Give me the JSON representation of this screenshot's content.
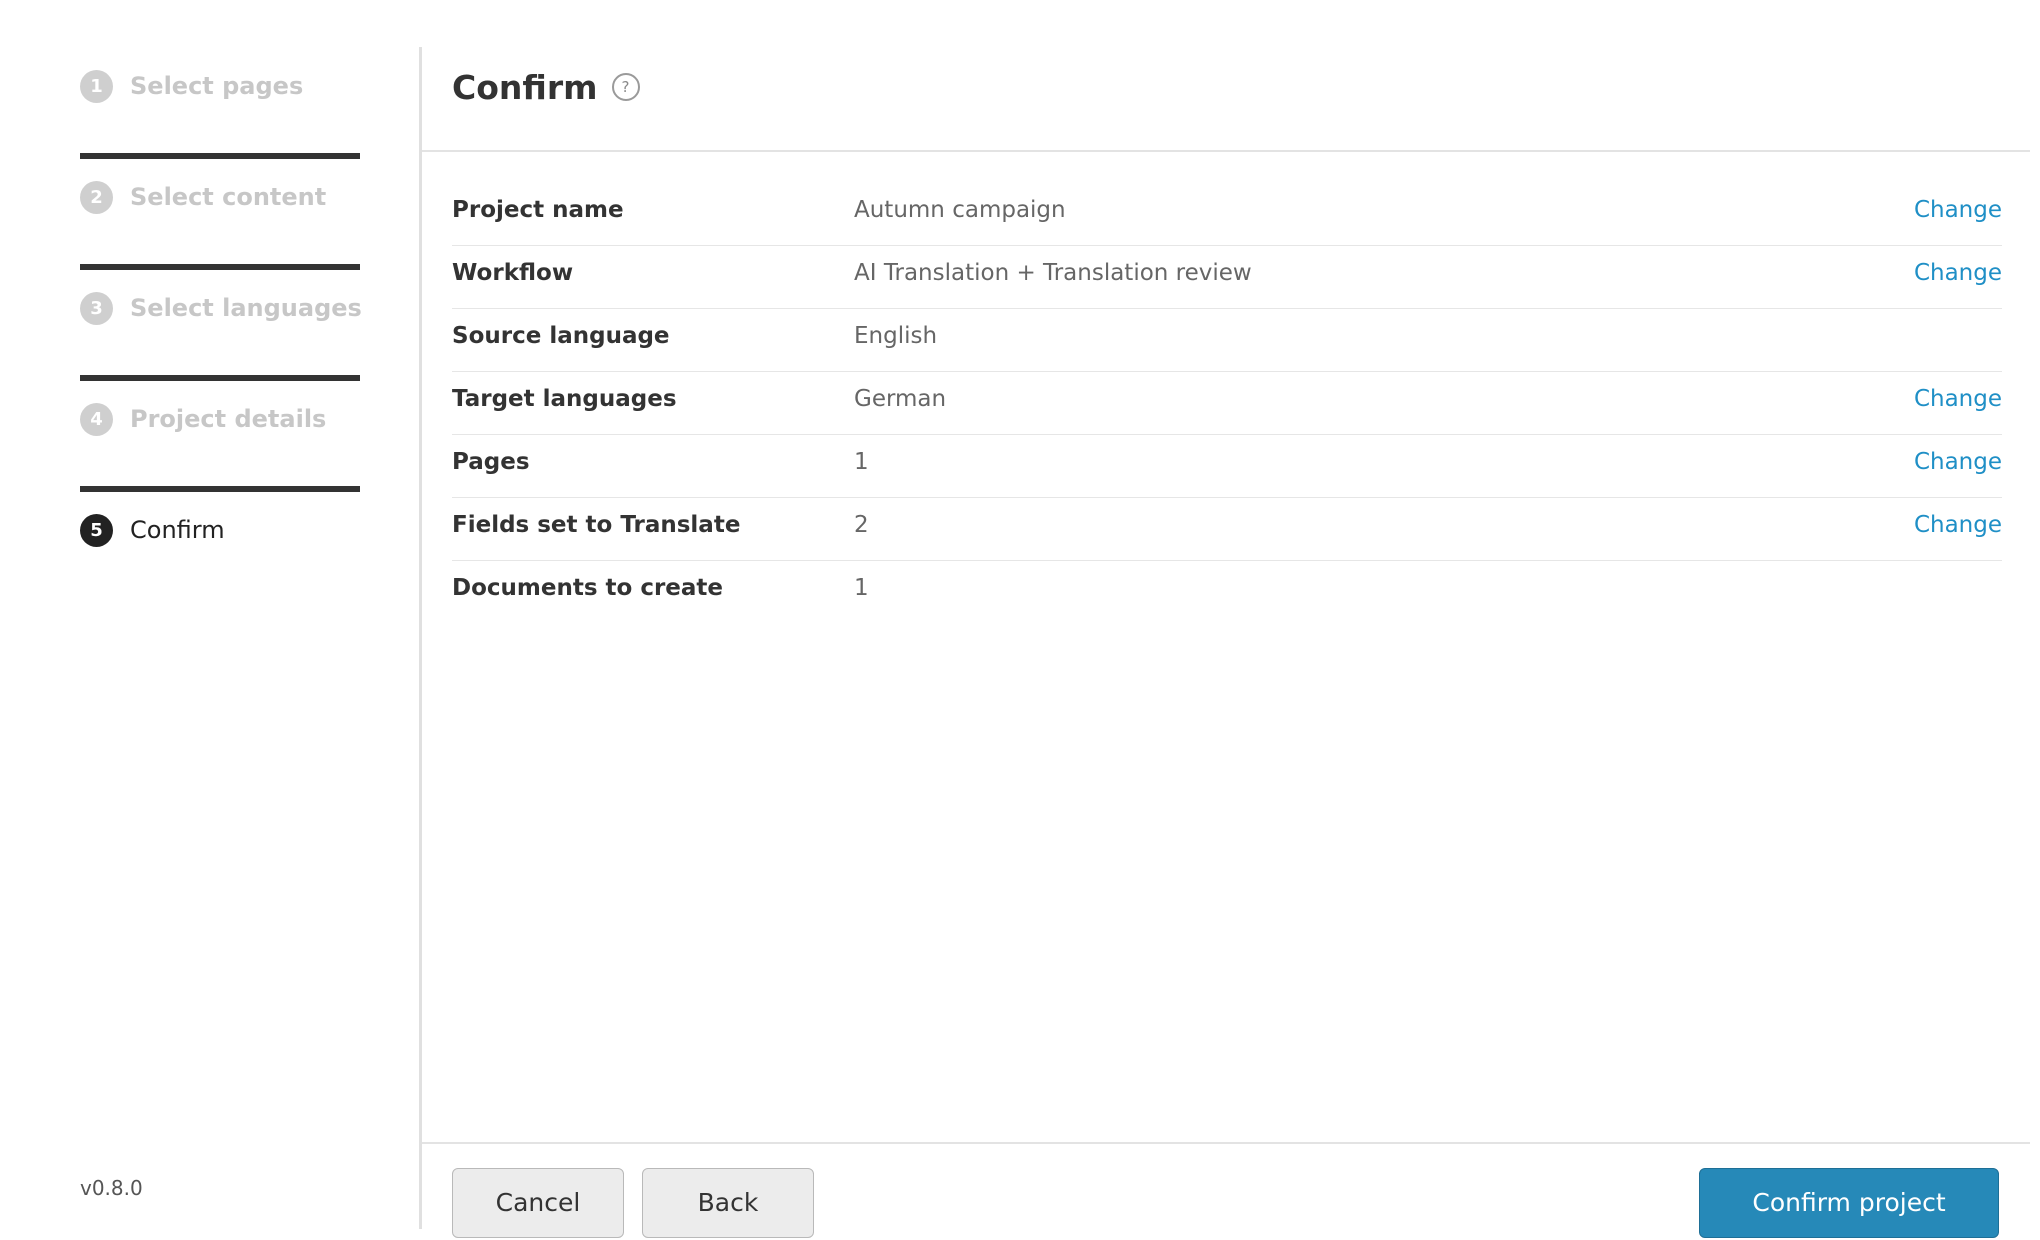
{
  "sidebar": {
    "steps": [
      {
        "number": "1",
        "label": "Select pages"
      },
      {
        "number": "2",
        "label": "Select content"
      },
      {
        "number": "3",
        "label": "Select languages"
      },
      {
        "number": "4",
        "label": "Project details"
      },
      {
        "number": "5",
        "label": "Confirm"
      }
    ],
    "version": "v0.8.0"
  },
  "main": {
    "title": "Confirm",
    "help_icon": "?",
    "rows": [
      {
        "key": "Project name",
        "value": "Autumn campaign",
        "action": "Change"
      },
      {
        "key": "Workflow",
        "value": "AI Translation + Translation review",
        "action": "Change"
      },
      {
        "key": "Source language",
        "value": "English"
      },
      {
        "key": "Target languages",
        "value": "German",
        "action": "Change"
      },
      {
        "key": "Pages",
        "value": "1",
        "action": "Change"
      },
      {
        "key": "Fields set to Translate",
        "value": "2",
        "action": "Change"
      },
      {
        "key": "Documents to create",
        "value": "1"
      }
    ]
  },
  "footer": {
    "cancel_label": "Cancel",
    "back_label": "Back",
    "confirm_label": "Confirm project"
  },
  "colors": {
    "primary": "#2689b8",
    "link": "#1f8fc6",
    "inactive_step": "#c7c7c7",
    "active_step": "#222222"
  }
}
